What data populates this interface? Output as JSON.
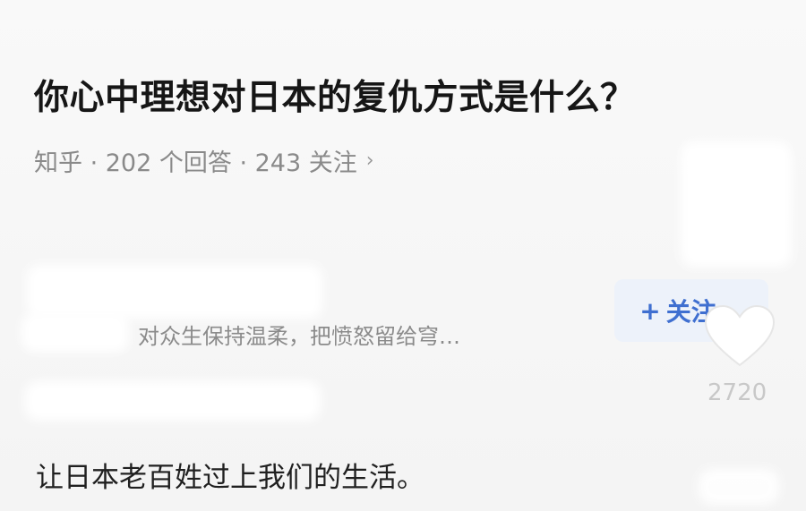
{
  "question": {
    "title": "你心中理想对日本的复仇方式是什么？",
    "meta": "知乎 · 202 个回答 · 243 关注",
    "chevron": "›"
  },
  "author": {
    "bio": "对众生保持温柔，把愤怒留给穹…",
    "follow_plus": "+",
    "follow_label": "关注"
  },
  "likes": {
    "count": "2720",
    "icon": "heart-icon"
  },
  "answer": {
    "text": "让日本老百姓过上我们的生活。"
  },
  "colors": {
    "follow_text": "#3f6fd0",
    "follow_bg": "#edf2fa",
    "meta_text": "#8a8a8a"
  }
}
